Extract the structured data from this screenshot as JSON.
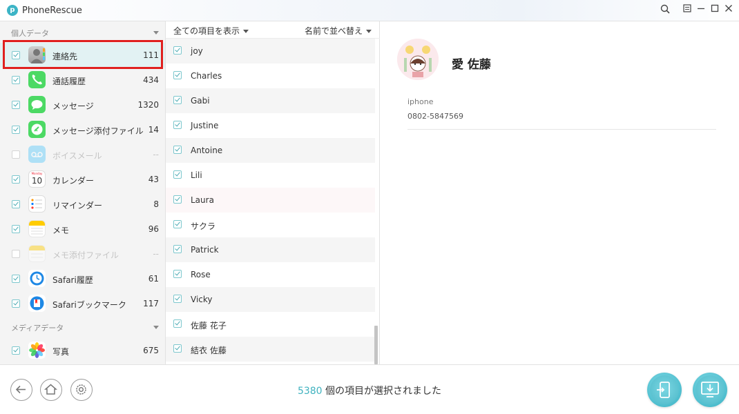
{
  "app": {
    "title": "PhoneRescue",
    "logo_letter": "p"
  },
  "sidebar": {
    "personal_header": "個人データ",
    "media_header": "メディアデータ",
    "categories": [
      {
        "label": "連絡先",
        "count": "111"
      },
      {
        "label": "通話履歴",
        "count": "434"
      },
      {
        "label": "メッセージ",
        "count": "1320"
      },
      {
        "label": "メッセージ添付ファイル",
        "count": "14"
      },
      {
        "label": "ボイスメール",
        "count": "--"
      },
      {
        "label": "カレンダー",
        "count": "43"
      },
      {
        "label": "リマインダー",
        "count": "8"
      },
      {
        "label": "メモ",
        "count": "96"
      },
      {
        "label": "メモ添付ファイル",
        "count": "--"
      },
      {
        "label": "Safari履歴",
        "count": "61"
      },
      {
        "label": "Safariブックマーク",
        "count": "117"
      },
      {
        "label": "写真",
        "count": "675"
      }
    ],
    "calendar_day": "10",
    "calendar_month": "Monday"
  },
  "list": {
    "filter_label": "全ての項目を表示",
    "sort_label": "名前で並べ替え",
    "items": [
      "joy",
      "Charles",
      "Gabi",
      "Justine",
      "Antoine",
      "Lili",
      "Laura",
      "サクラ",
      "Patrick",
      "Rose",
      "Vicky",
      "佐藤 花子",
      "結衣 佐藤"
    ]
  },
  "detail": {
    "name": "愛 佐藤",
    "field_label": "iphone",
    "field_value": "0802-5847569"
  },
  "bottom": {
    "selected_count": "5380",
    "status_suffix": " 個の項目が選択されました"
  },
  "colors": {
    "accent": "#3fb2bf",
    "highlight": "#e0201e",
    "active_row": "#e2f2f3"
  }
}
